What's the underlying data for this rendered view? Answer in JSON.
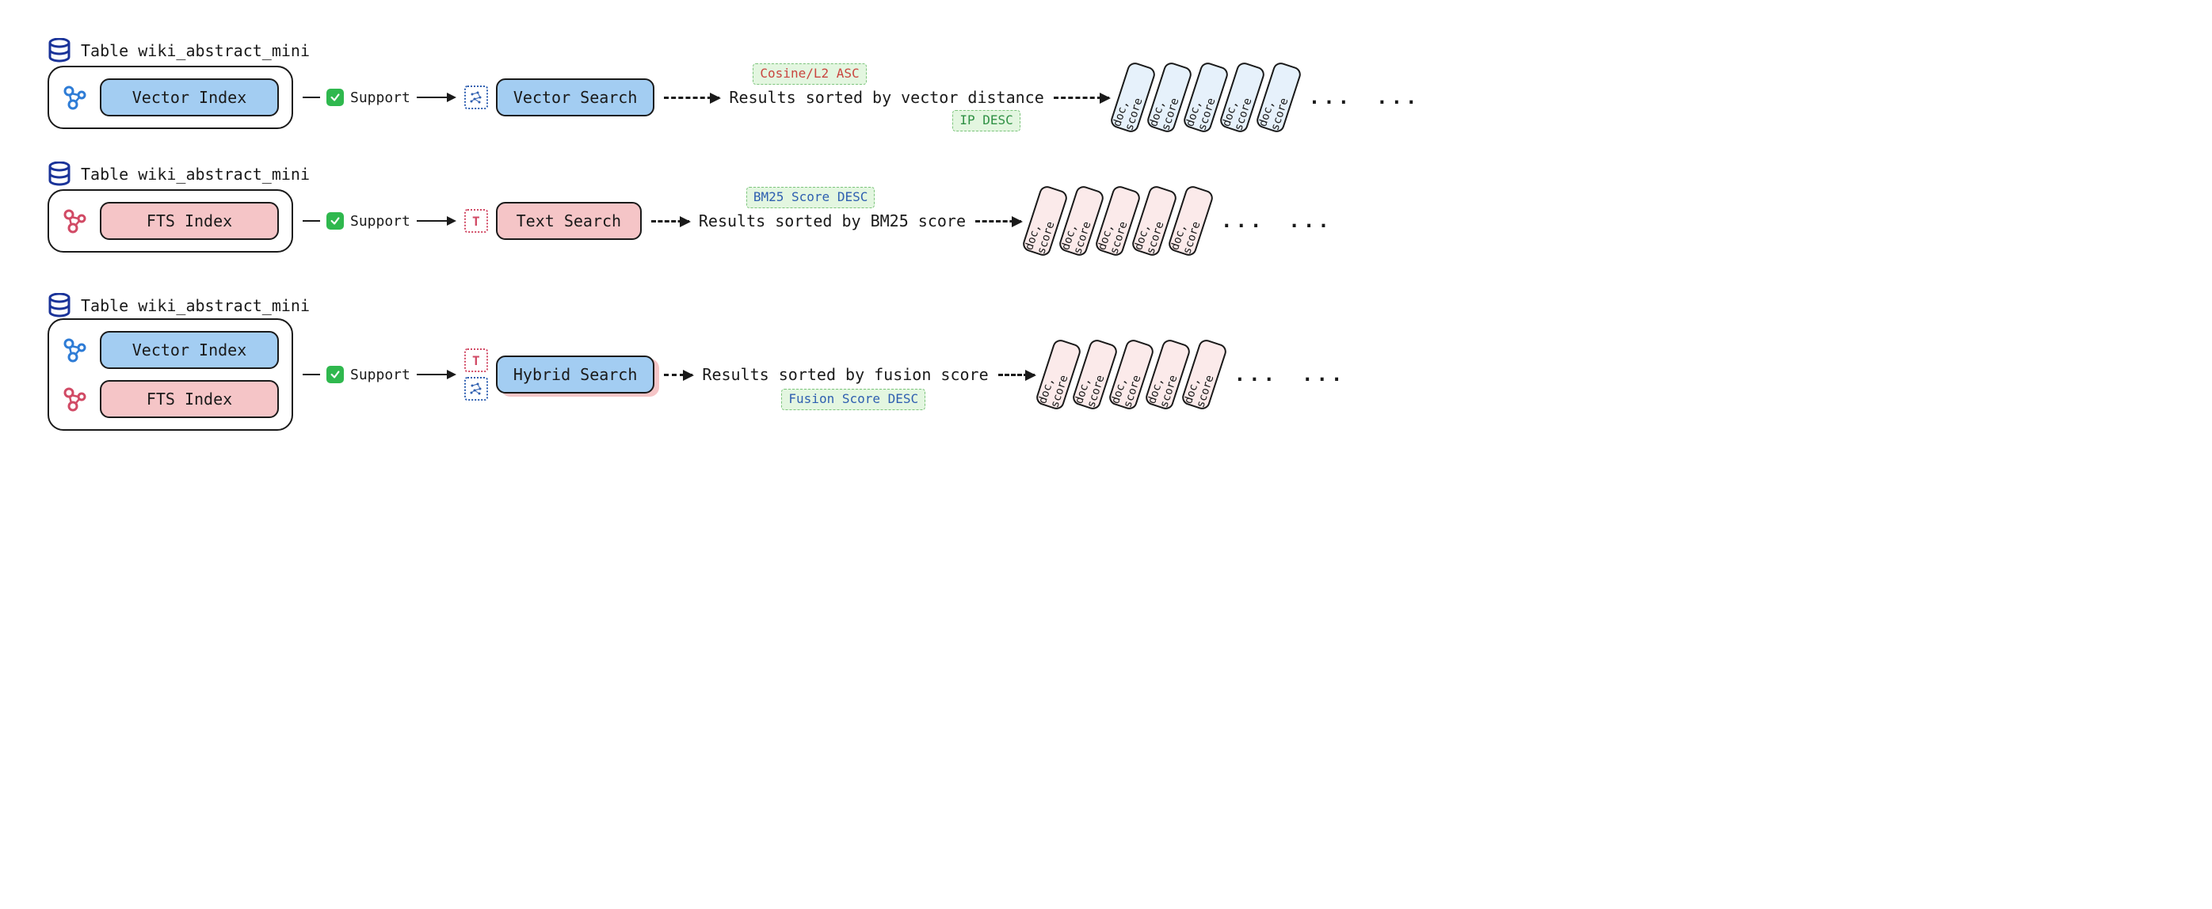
{
  "table_name": "Table wiki_abstract_mini",
  "support_label": "Support",
  "doc_label": "doc, score",
  "ellipsis": "...",
  "rows": {
    "vector": {
      "index_label": "Vector Index",
      "search_label": "Vector Search",
      "result_text": "Results sorted by vector distance",
      "badge_top": "Cosine/L2 ASC",
      "badge_bottom": "IP DESC"
    },
    "text": {
      "index_label": "FTS Index",
      "search_label": "Text Search",
      "result_text": "Results sorted by BM25 score",
      "badge_top": "BM25 Score DESC"
    },
    "hybrid": {
      "vector_index_label": "Vector Index",
      "fts_index_label": "FTS Index",
      "search_label": "Hybrid Search",
      "result_text": "Results sorted by fusion score",
      "badge_bottom": "Fusion Score DESC"
    }
  }
}
